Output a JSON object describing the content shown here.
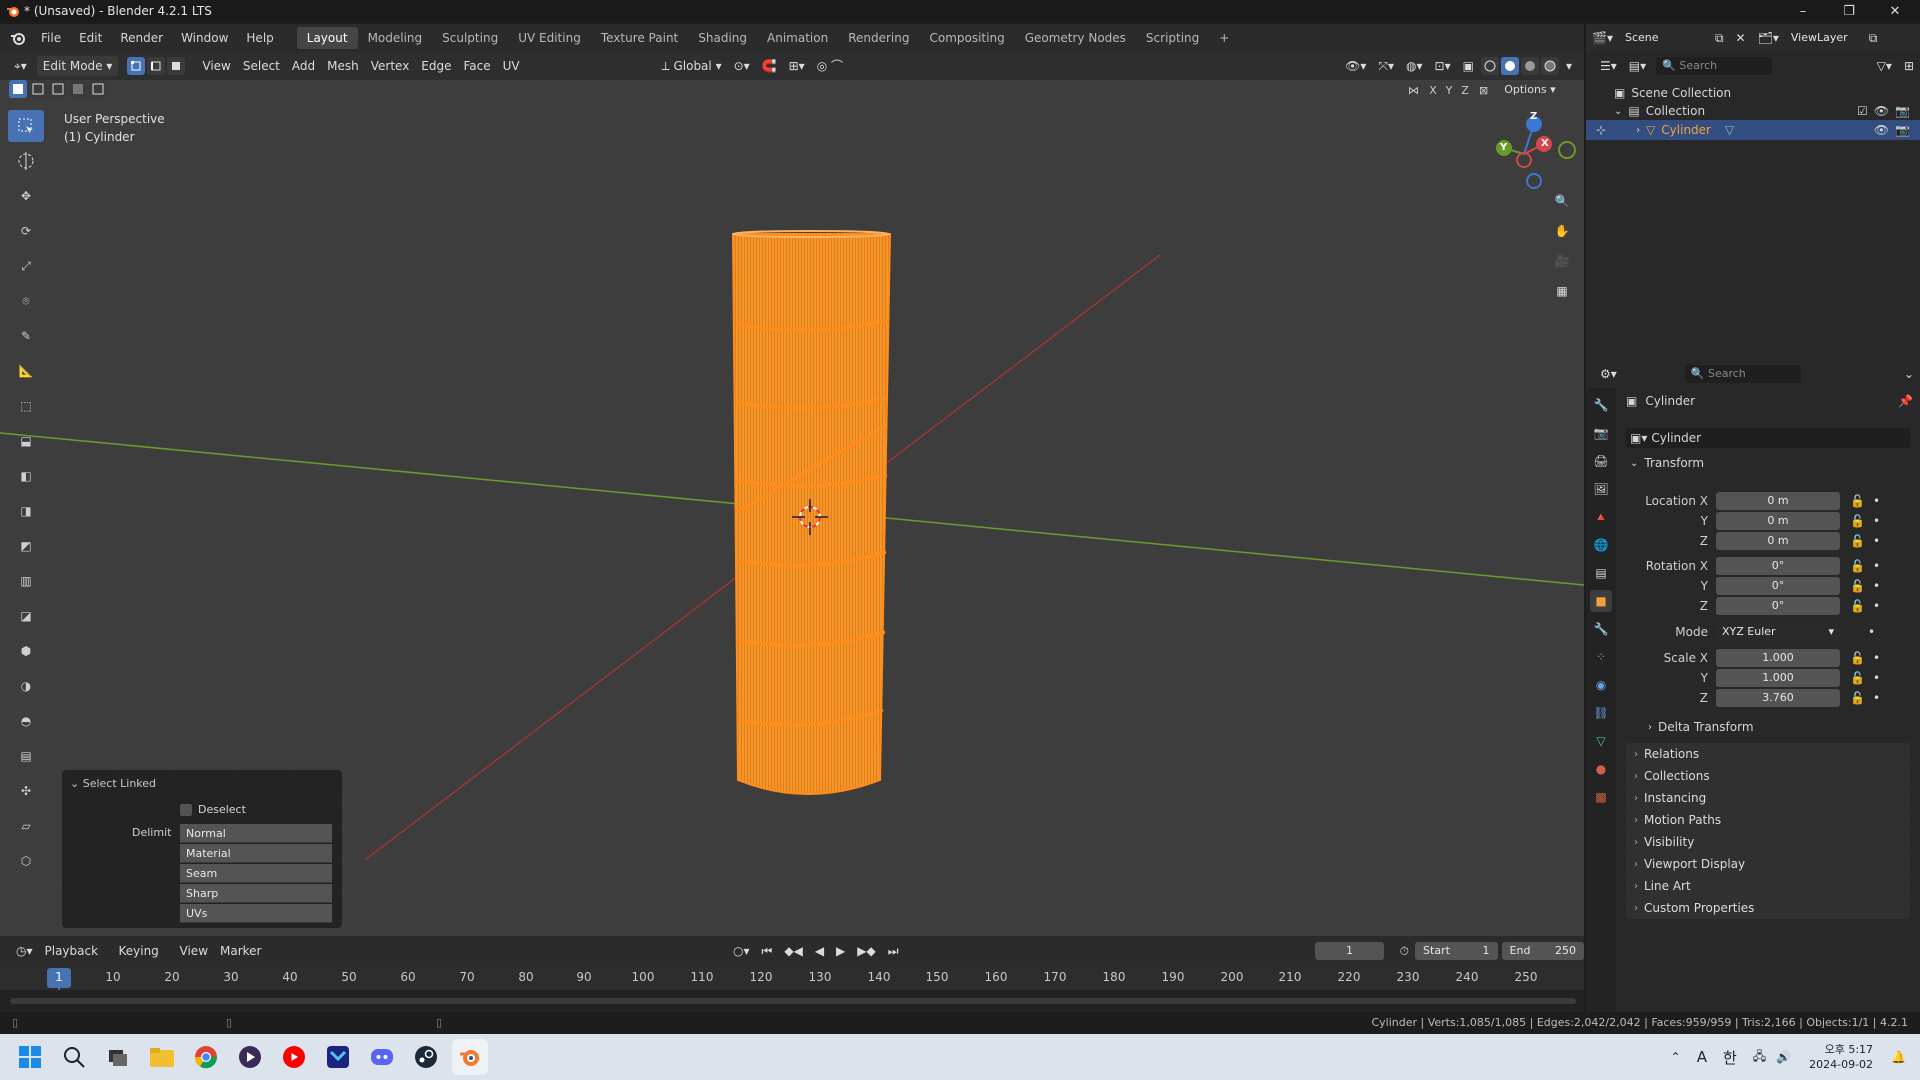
{
  "window": {
    "title": "* (Unsaved) - Blender 4.2.1 LTS"
  },
  "menu": [
    "File",
    "Edit",
    "Render",
    "Window",
    "Help"
  ],
  "workspaces": [
    "Layout",
    "Modeling",
    "Sculpting",
    "UV Editing",
    "Texture Paint",
    "Shading",
    "Animation",
    "Rendering",
    "Compositing",
    "Geometry Nodes",
    "Scripting"
  ],
  "scene": {
    "label": "Scene",
    "view_layer": "ViewLayer"
  },
  "viewport_header": {
    "mode": "Edit Mode",
    "menus": [
      "View",
      "Select",
      "Add",
      "Mesh",
      "Vertex",
      "Edge",
      "Face",
      "UV"
    ],
    "orientation": "Global",
    "options": "Options",
    "axes": [
      "X",
      "Y",
      "Z"
    ]
  },
  "viewport": {
    "perspective": "User Perspective",
    "object": "(1) Cylinder",
    "gizmo_axes": [
      "Z",
      "Y",
      "X"
    ]
  },
  "operator_panel": {
    "title": "Select Linked",
    "deselect": "Deselect",
    "delimit_label": "Delimit",
    "delimit_options": [
      "Normal",
      "Material",
      "Seam",
      "Sharp",
      "UVs"
    ]
  },
  "timeline": {
    "menus": [
      "Playback",
      "Keying",
      "View",
      "Marker"
    ],
    "current_frame": "1",
    "start_label": "Start",
    "start": "1",
    "end_label": "End",
    "end": "250",
    "ticks": [
      "1",
      "10",
      "20",
      "30",
      "40",
      "50",
      "60",
      "70",
      "80",
      "90",
      "100",
      "110",
      "120",
      "130",
      "140",
      "150",
      "160",
      "170",
      "180",
      "190",
      "200",
      "210",
      "220",
      "230",
      "240",
      "250"
    ]
  },
  "outliner": {
    "search_placeholder": "Search",
    "scene_collection": "Scene Collection",
    "collection": "Collection",
    "object": "Cylinder"
  },
  "properties": {
    "search_placeholder": "Search",
    "object_name": "Cylinder",
    "datablock": "Cylinder",
    "transform_label": "Transform",
    "location_x_label": "Location X",
    "location_x": "0 m",
    "location_y_label": "Y",
    "location_y": "0 m",
    "location_z_label": "Z",
    "location_z": "0 m",
    "rotation_x_label": "Rotation X",
    "rotation_x": "0°",
    "rotation_y_label": "Y",
    "rotation_y": "0°",
    "rotation_z_label": "Z",
    "rotation_z": "0°",
    "mode_label": "Mode",
    "mode": "XYZ Euler",
    "scale_x_label": "Scale X",
    "scale_x": "1.000",
    "scale_y_label": "Y",
    "scale_y": "1.000",
    "scale_z_label": "Z",
    "scale_z": "3.760",
    "delta": "Delta Transform",
    "panels": [
      "Relations",
      "Collections",
      "Instancing",
      "Motion Paths",
      "Visibility",
      "Viewport Display",
      "Line Art",
      "Custom Properties"
    ]
  },
  "status": "Cylinder | Verts:1,085/1,085 | Edges:2,042/2,042 | Faces:959/959 | Tris:2,166 | Objects:1/1 | 4.2.1",
  "taskbar": {
    "ime": "A",
    "ime2": "한",
    "time": "오후 5:17",
    "date": "2024-09-02"
  },
  "colors": {
    "accent": "#4772b3",
    "selection": "#ff8c1a",
    "background": "#3d3d3d"
  }
}
